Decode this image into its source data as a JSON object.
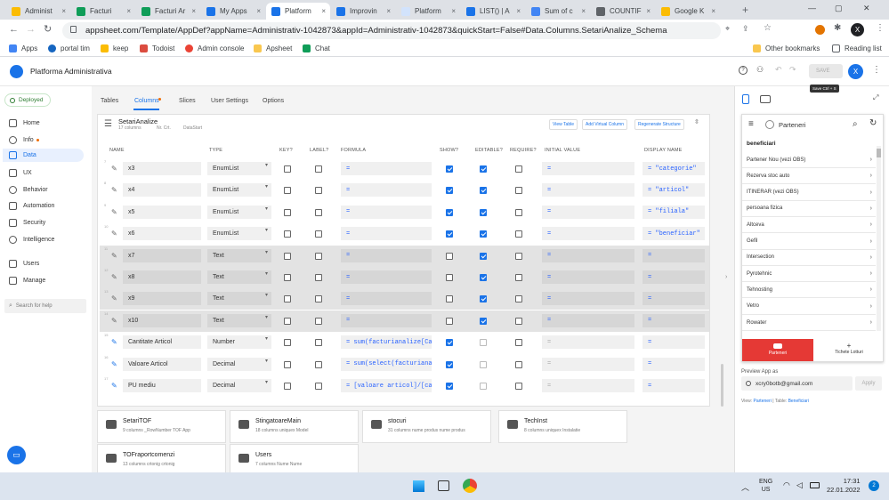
{
  "browser": {
    "tabs": [
      {
        "label": "Administ",
        "color": "#fbbc04"
      },
      {
        "label": "Facturi",
        "color": "#0f9d58"
      },
      {
        "label": "Facturi Ar",
        "color": "#0f9d58"
      },
      {
        "label": "My Apps",
        "color": "#1a73e8"
      },
      {
        "label": "Platform",
        "color": "#1a73e8"
      },
      {
        "label": "Improvin",
        "color": "#1a73e8"
      },
      {
        "label": "Platform",
        "color": "#d2e3fc"
      },
      {
        "label": "LIST() | A",
        "color": "#1a73e8"
      },
      {
        "label": "Sum of c",
        "color": "#4285f4"
      },
      {
        "label": "COUNTIF",
        "color": "#5f6368"
      },
      {
        "label": "Google K",
        "color": "#fbbc04"
      }
    ],
    "url": "appsheet.com/Template/AppDef?appName=Administrativ-1042873&appId=Administrativ-1042873&quickStart=False#Data.Columns.SetariAnalize_Schema",
    "bookmarks": [
      "Apps",
      "portal tim",
      "keep",
      "Todoist",
      "Admin console",
      "Apsheet",
      "Chat"
    ],
    "other_bookmarks": "Other bookmarks",
    "reading_list": "Reading list",
    "profile_initial": "X"
  },
  "app": {
    "title": "Platforma Administrativa",
    "save_label": "SAVE",
    "save_tooltip": "Save Ctrl + S",
    "deployed": "Deployed"
  },
  "nav": {
    "items": [
      "Home",
      "Info",
      "Data",
      "UX",
      "Behavior",
      "Automation",
      "Security",
      "Intelligence",
      "Users",
      "Manage"
    ],
    "search_placeholder": "Search for help"
  },
  "subtabs": [
    "Tables",
    "Columns",
    "Slices",
    "User Settings",
    "Options"
  ],
  "table_card": {
    "name": "SetariAnalize",
    "meta_count": "17 columns",
    "meta_key": "Nr. Crt.",
    "meta_source": "DataStart",
    "btn_view": "View Table",
    "btn_add": "Add Virtual Column",
    "btn_regen": "Regenerate Structure"
  },
  "columns_header": [
    "NAME",
    "TYPE",
    "KEY?",
    "LABEL?",
    "FORMULA",
    "SHOW?",
    "EDITABLE?",
    "REQUIRE?",
    "INITIAL VALUE",
    "DISPLAY NAME"
  ],
  "rows": [
    {
      "n": "7",
      "name": "x3",
      "type": "EnumList",
      "key": false,
      "label": false,
      "formula": "=",
      "show": true,
      "edit": true,
      "req": false,
      "init": "=",
      "disp": "= \"categorie\"",
      "edit_dis": false
    },
    {
      "n": "8",
      "name": "x4",
      "type": "EnumList",
      "key": false,
      "label": false,
      "formula": "=",
      "show": true,
      "edit": true,
      "req": false,
      "init": "=",
      "disp": "= \"articol\"",
      "edit_dis": false
    },
    {
      "n": "9",
      "name": "x5",
      "type": "EnumList",
      "key": false,
      "label": false,
      "formula": "=",
      "show": true,
      "edit": true,
      "req": false,
      "init": "=",
      "disp": "= \"filiala\"",
      "edit_dis": false
    },
    {
      "n": "10",
      "name": "x6",
      "type": "EnumList",
      "key": false,
      "label": false,
      "formula": "=",
      "show": true,
      "edit": true,
      "req": false,
      "init": "=",
      "disp": "= \"beneficiar\"",
      "edit_dis": false
    },
    {
      "n": "11",
      "name": "x7",
      "type": "Text",
      "key": false,
      "label": false,
      "formula": "=",
      "show": false,
      "edit": true,
      "req": false,
      "init": "=",
      "disp": "=",
      "edit_dis": false
    },
    {
      "n": "12",
      "name": "x8",
      "type": "Text",
      "key": false,
      "label": false,
      "formula": "=",
      "show": false,
      "edit": true,
      "req": false,
      "init": "=",
      "disp": "=",
      "edit_dis": false
    },
    {
      "n": "13",
      "name": "x9",
      "type": "Text",
      "key": false,
      "label": false,
      "formula": "=",
      "show": false,
      "edit": true,
      "req": false,
      "init": "=",
      "disp": "=",
      "edit_dis": false
    },
    {
      "n": "14",
      "name": "x10",
      "type": "Text",
      "key": false,
      "label": false,
      "formula": "=",
      "show": false,
      "edit": true,
      "req": false,
      "init": "=",
      "disp": "=",
      "edit_dis": false
    },
    {
      "n": "15",
      "name": "Cantitate Articol",
      "type": "Number",
      "key": false,
      "label": false,
      "formula": "= sum(facturianalize[Ca",
      "show": true,
      "edit": false,
      "req": false,
      "init": "=",
      "disp": "=",
      "edit_dis": true
    },
    {
      "n": "16",
      "name": "Valoare Articol",
      "type": "Decimal",
      "key": false,
      "label": false,
      "formula": "= sum(select(facturiana",
      "show": true,
      "edit": false,
      "req": false,
      "init": "=",
      "disp": "=",
      "edit_dis": true
    },
    {
      "n": "17",
      "name": "PU mediu",
      "type": "Decimal",
      "key": false,
      "label": false,
      "formula": "= [valoare articol]/[ca",
      "show": true,
      "edit": false,
      "req": false,
      "init": "=",
      "disp": "=",
      "edit_dis": true
    }
  ],
  "tables": [
    {
      "name": "SetariTOF",
      "meta": "9 columns  _RowNumber  TOF App"
    },
    {
      "name": "StingatoareMain",
      "meta": "18 columns  uniquex  Model"
    },
    {
      "name": "stocuri",
      "meta": "31 columns  nume produs  nume produs"
    },
    {
      "name": "TechInst",
      "meta": "8 columns  uniquex  Instalatie"
    },
    {
      "name": "TOFraportcomenzi",
      "meta": "13 columns  crtonig  crtonig"
    },
    {
      "name": "Users",
      "meta": "7 columns  Nume  Nume"
    }
  ],
  "preview": {
    "header_title": "Parteneri",
    "section": "beneficiari",
    "items": [
      "Partener Nou (vezi OBS)",
      "Rezerva stoc auto",
      "ITINERAR (vezi OBS)",
      "persoana fizica",
      "Altceva",
      "Gefil",
      "Intersection",
      "Pyrotehnic",
      "Tehnosting",
      "Vetro",
      "Rowater"
    ],
    "nav_active": "Parteneri",
    "nav_other": "Tichete Lotturi",
    "preview_as_label": "Preview App as",
    "email": "xcry0botb@gmail.com",
    "apply": "Apply",
    "view_line_view": "View:",
    "view_line_view_val": "Parteneri",
    "view_line_table": "Table:",
    "view_line_table_val": "Beneficiari"
  },
  "taskbar": {
    "lang1": "ENG",
    "lang2": "US",
    "time": "17:31",
    "date": "22.01.2022",
    "notif": "2"
  },
  "colors": {
    "accent": "#1a73e8",
    "brand_red": "#e53935",
    "selected_row": "#e3e3e3"
  }
}
